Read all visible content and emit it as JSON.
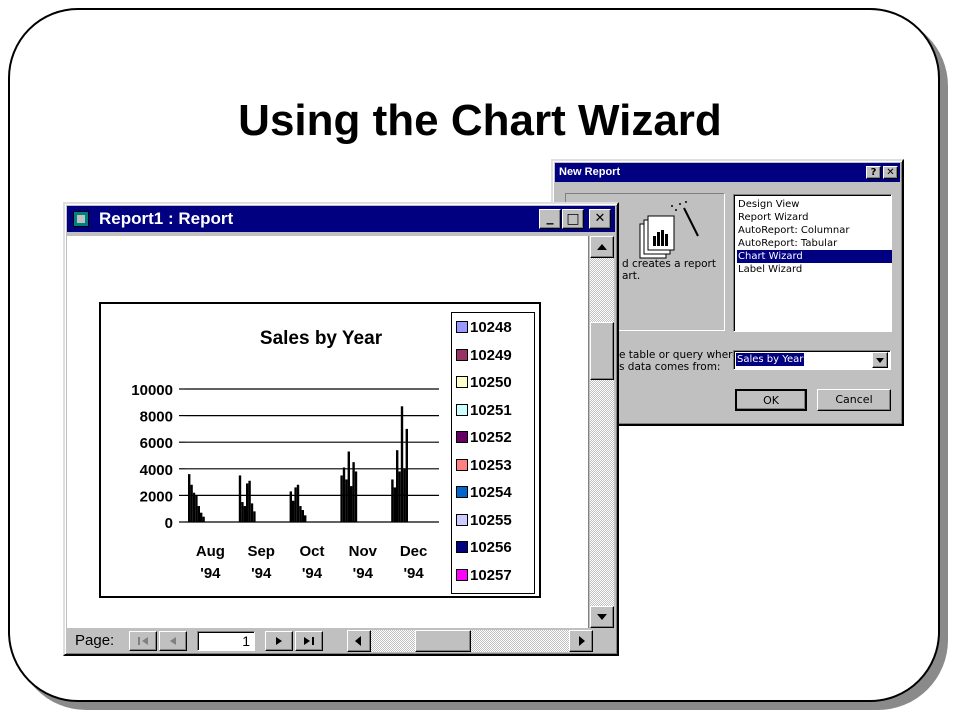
{
  "slide": {
    "title": "Using the Chart Wizard"
  },
  "report_window": {
    "title": "Report1 : Report",
    "buttons": {
      "minimize": "_",
      "maximize": "□",
      "close": "✕"
    },
    "status": {
      "page_label": "Page:",
      "page_number": "1"
    }
  },
  "chart_data": {
    "type": "bar",
    "title": "Sales by Year",
    "categories": [
      "Aug '94",
      "Sep '94",
      "Oct '94",
      "Nov '94",
      "Dec '94"
    ],
    "category_month": [
      "Aug",
      "Sep",
      "Oct",
      "Nov",
      "Dec"
    ],
    "category_year": [
      "'94",
      "'94",
      "'94",
      "'94",
      "'94"
    ],
    "ylim": [
      0,
      10000
    ],
    "yticks": [
      "10000",
      "8000",
      "6000",
      "4000",
      "2000",
      "0"
    ],
    "grid": true,
    "legend": [
      "10248",
      "10249",
      "10250",
      "10251",
      "10252",
      "10253",
      "10254",
      "10255",
      "10256",
      "10257"
    ],
    "legend_colors": [
      "#9999ff",
      "#993366",
      "#ffffcc",
      "#ccffff",
      "#660066",
      "#ff8080",
      "#0066cc",
      "#ccccff",
      "#000080",
      "#ff00ff"
    ],
    "legend_placement": "right",
    "values": [
      [
        3600,
        2800,
        2200,
        2000,
        1200,
        700,
        400
      ],
      [
        3500,
        1500,
        1200,
        2900,
        3100,
        1400,
        800
      ],
      [
        2300,
        1600,
        2600,
        2800,
        1200,
        900,
        500
      ],
      [
        3500,
        4100,
        3200,
        5300,
        2700,
        4500,
        3800
      ],
      [
        3200,
        2600,
        5400,
        3800,
        8700,
        4000,
        7000
      ]
    ]
  },
  "dialog": {
    "title": "New Report",
    "help_button": "?",
    "close_button": "✕",
    "description_line1": "d creates a report",
    "description_line2": "art.",
    "list_items": [
      "Design View",
      "Report Wizard",
      "AutoReport:  Columnar",
      "AutoReport:  Tabular",
      "Chart Wizard",
      "Label Wizard"
    ],
    "selected_index": 4,
    "source_prompt_line1": "e table or query where",
    "source_prompt_line2": "s data comes from:",
    "source_value": "Sales by Year",
    "ok_label": "OK",
    "cancel_label": "Cancel"
  },
  "colors": {
    "titlebar": "#000080",
    "face": "#c0c0c0",
    "bars": "#000000"
  }
}
